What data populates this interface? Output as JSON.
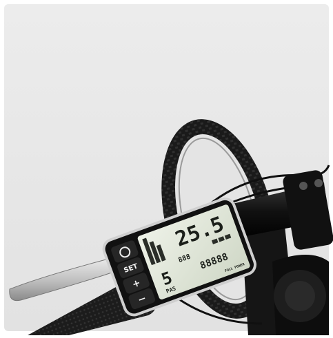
{
  "photo": {
    "subject": "e-bike LCD display on handlebar",
    "background_color": "#e6e6e6",
    "accent_lcd_color": "#dfe6d8"
  },
  "display": {
    "speed": "25.5",
    "pas_value": "5",
    "pas_label": "PAS",
    "small_readout": "888",
    "odometer": "88888",
    "brand_marking": "FULL POWER",
    "buttons": [
      {
        "icon": "power-icon"
      },
      {
        "label": "SET"
      },
      {
        "icon": "plus-icon"
      },
      {
        "icon": "minus-icon"
      }
    ]
  }
}
